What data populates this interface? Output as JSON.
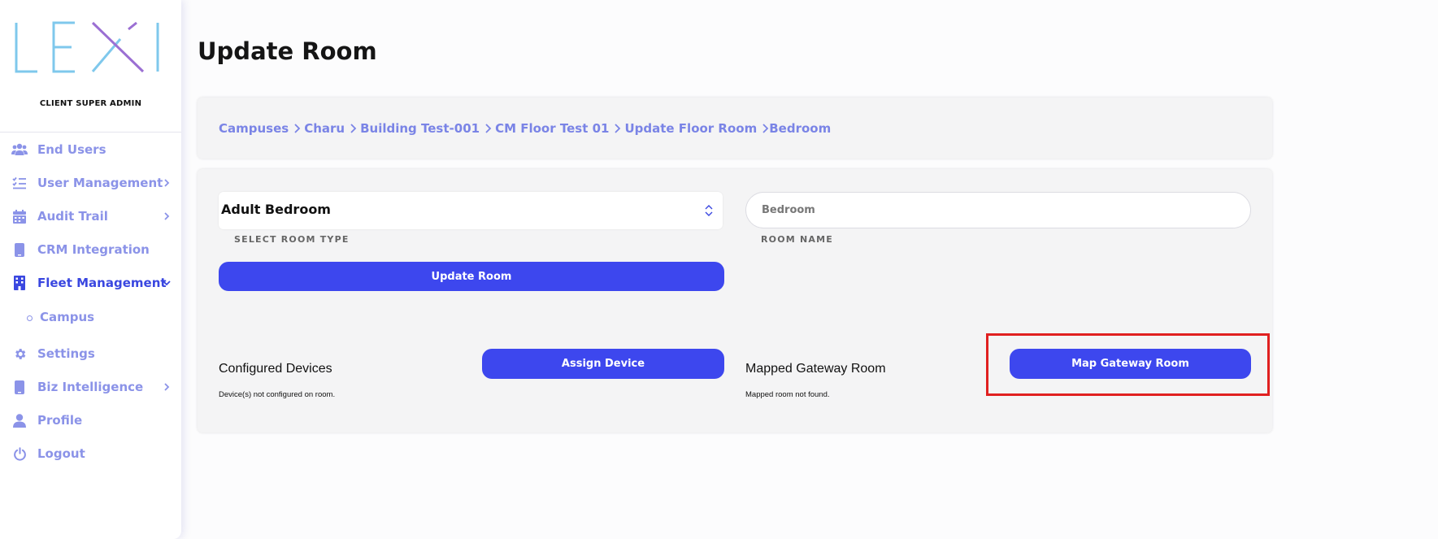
{
  "brand": {
    "logo_text": "LEXI",
    "role": "CLIENT SUPER ADMIN"
  },
  "sidebar": {
    "items": [
      {
        "label": "End Users",
        "icon": "users-icon",
        "has_chevron": false
      },
      {
        "label": "User Management",
        "icon": "list-check-icon",
        "has_chevron": true
      },
      {
        "label": "Audit Trail",
        "icon": "calendar-icon",
        "has_chevron": true
      },
      {
        "label": "CRM Integration",
        "icon": "phone-icon",
        "has_chevron": false
      },
      {
        "label": "Fleet Management",
        "icon": "building-icon",
        "has_chevron": true,
        "expanded": true,
        "active": true
      },
      {
        "label": "Campus",
        "icon": "circle-bullet-icon",
        "sub": true
      },
      {
        "label": "Settings",
        "icon": "gear-icon",
        "has_chevron": false
      },
      {
        "label": "Biz Intelligence",
        "icon": "phone-icon",
        "has_chevron": true
      },
      {
        "label": "Profile",
        "icon": "user-icon",
        "has_chevron": false
      },
      {
        "label": "Logout",
        "icon": "power-icon",
        "has_chevron": false
      }
    ]
  },
  "page": {
    "title": "Update Room"
  },
  "breadcrumb": [
    "Campuses",
    "Charu",
    "Building Test-001",
    "CM Floor Test 01",
    "Update Floor Room",
    "Bedroom"
  ],
  "form": {
    "room_type_value": "Adult Bedroom",
    "room_type_label": "SELECT ROOM TYPE",
    "room_name_value": "Bedroom",
    "room_name_label": "ROOM NAME",
    "update_button": "Update Room"
  },
  "devices": {
    "title": "Configured Devices",
    "note": "Device(s) not configured on room.",
    "button": "Assign Device"
  },
  "gateway": {
    "title": "Mapped Gateway Room",
    "note": "Mapped room not found.",
    "button": "Map Gateway Room"
  },
  "colors": {
    "accent": "#3d47ee",
    "nav_text": "#8b93e8",
    "nav_active": "#3a47e0",
    "highlight_border": "#e02020"
  }
}
